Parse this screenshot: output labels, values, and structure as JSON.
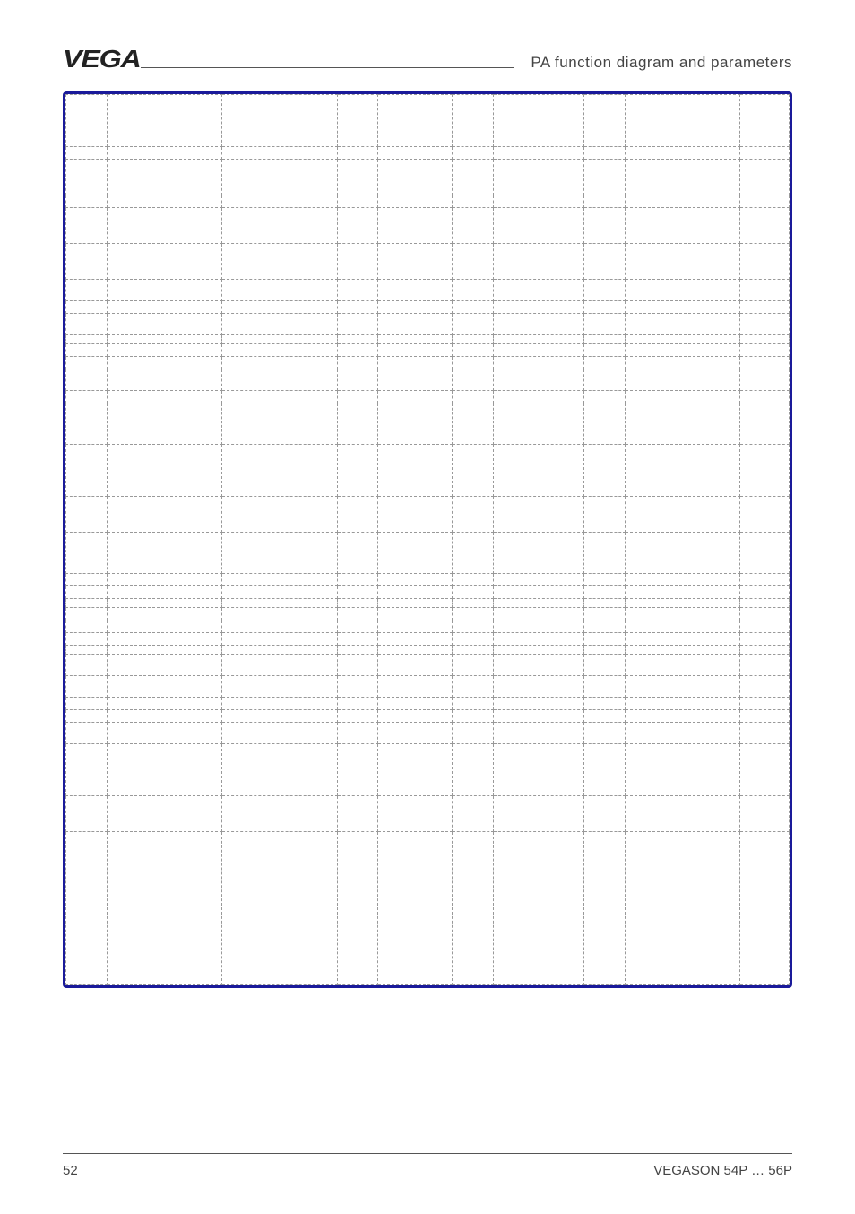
{
  "header": {
    "logo_text": "VEGA",
    "title": "PA function diagram and parameters"
  },
  "table": {
    "column_count": 10,
    "rows": [
      {
        "size": "lg",
        "cells": [
          "",
          "",
          "",
          "",
          "",
          "",
          "",
          "",
          "",
          ""
        ]
      },
      {
        "size": "xs",
        "cells": [
          "",
          "",
          "",
          "",
          "",
          "",
          "",
          "",
          "",
          ""
        ]
      },
      {
        "size": "md",
        "cells": [
          "",
          "",
          "",
          "",
          "",
          "",
          "",
          "",
          "",
          ""
        ]
      },
      {
        "size": "xs",
        "cells": [
          "",
          "",
          "",
          "",
          "",
          "",
          "",
          "",
          "",
          ""
        ]
      },
      {
        "size": "md",
        "cells": [
          "",
          "",
          "",
          "",
          "",
          "",
          "",
          "",
          "",
          ""
        ]
      },
      {
        "size": "md",
        "cells": [
          "",
          "",
          "",
          "",
          "",
          "",
          "",
          "",
          "",
          ""
        ]
      },
      {
        "size": "sm",
        "cells": [
          "",
          "",
          "",
          "",
          "",
          "",
          "",
          "",
          "",
          ""
        ]
      },
      {
        "size": "xs",
        "cells": [
          "",
          "",
          "",
          "",
          "",
          "",
          "",
          "",
          "",
          ""
        ]
      },
      {
        "size": "sm",
        "cells": [
          "",
          "",
          "",
          "",
          "",
          "",
          "",
          "",
          "",
          ""
        ]
      },
      {
        "size": "tiny",
        "cells": [
          "",
          "",
          "",
          "",
          "",
          "",
          "",
          "",
          "",
          ""
        ]
      },
      {
        "size": "xs",
        "cells": [
          "",
          "",
          "",
          "",
          "",
          "",
          "",
          "",
          "",
          ""
        ]
      },
      {
        "size": "xs",
        "cells": [
          "",
          "",
          "",
          "",
          "",
          "",
          "",
          "",
          "",
          ""
        ]
      },
      {
        "size": "sm",
        "cells": [
          "",
          "",
          "",
          "",
          "",
          "",
          "",
          "",
          "",
          ""
        ]
      },
      {
        "size": "xs",
        "cells": [
          "",
          "",
          "",
          "",
          "",
          "",
          "",
          "",
          "",
          ""
        ]
      },
      {
        "size": "mdl",
        "cells": [
          "",
          "",
          "",
          "",
          "",
          "",
          "",
          "",
          "",
          ""
        ]
      },
      {
        "size": "lg",
        "cells": [
          "",
          "",
          "",
          "",
          "",
          "",
          "",
          "",
          "",
          ""
        ]
      },
      {
        "size": "md",
        "cells": [
          "",
          "",
          "",
          "",
          "",
          "",
          "",
          "",
          "",
          ""
        ]
      },
      {
        "size": "mdl",
        "cells": [
          "",
          "",
          "",
          "",
          "",
          "",
          "",
          "",
          "",
          ""
        ]
      },
      {
        "size": "xs",
        "cells": [
          "",
          "",
          "",
          "",
          "",
          "",
          "",
          "",
          "",
          ""
        ]
      },
      {
        "size": "xs",
        "cells": [
          "",
          "",
          "",
          "",
          "",
          "",
          "",
          "",
          "",
          ""
        ]
      },
      {
        "size": "tiny",
        "cells": [
          "",
          "",
          "",
          "",
          "",
          "",
          "",
          "",
          "",
          ""
        ]
      },
      {
        "size": "xs",
        "cells": [
          "",
          "",
          "",
          "",
          "",
          "",
          "",
          "",
          "",
          ""
        ]
      },
      {
        "size": "xs",
        "cells": [
          "",
          "",
          "",
          "",
          "",
          "",
          "",
          "",
          "",
          ""
        ]
      },
      {
        "size": "xs",
        "cells": [
          "",
          "",
          "",
          "",
          "",
          "",
          "",
          "",
          "",
          ""
        ]
      },
      {
        "size": "tiny",
        "cells": [
          "",
          "",
          "",
          "",
          "",
          "",
          "",
          "",
          "",
          ""
        ]
      },
      {
        "size": "sm",
        "cells": [
          "",
          "",
          "",
          "",
          "",
          "",
          "",
          "",
          "",
          ""
        ]
      },
      {
        "size": "sm",
        "cells": [
          "",
          "",
          "",
          "",
          "",
          "",
          "",
          "",
          "",
          ""
        ]
      },
      {
        "size": "xs",
        "cells": [
          "",
          "",
          "",
          "",
          "",
          "",
          "",
          "",
          "",
          ""
        ]
      },
      {
        "size": "xs",
        "cells": [
          "",
          "",
          "",
          "",
          "",
          "",
          "",
          "",
          "",
          ""
        ]
      },
      {
        "size": "sm",
        "cells": [
          "",
          "",
          "",
          "",
          "",
          "",
          "",
          "",
          "",
          ""
        ]
      },
      {
        "size": "lg",
        "cells": [
          "",
          "",
          "",
          "",
          "",
          "",
          "",
          "",
          "",
          ""
        ]
      },
      {
        "size": "md",
        "cells": [
          "",
          "",
          "",
          "",
          "",
          "",
          "",
          "",
          "",
          ""
        ]
      },
      {
        "size": "rem",
        "cells": [
          "",
          "",
          "",
          "",
          "",
          "",
          "",
          "",
          "",
          ""
        ]
      }
    ]
  },
  "footer": {
    "page_number": "52",
    "doc_name": "VEGASON 54P … 56P"
  }
}
